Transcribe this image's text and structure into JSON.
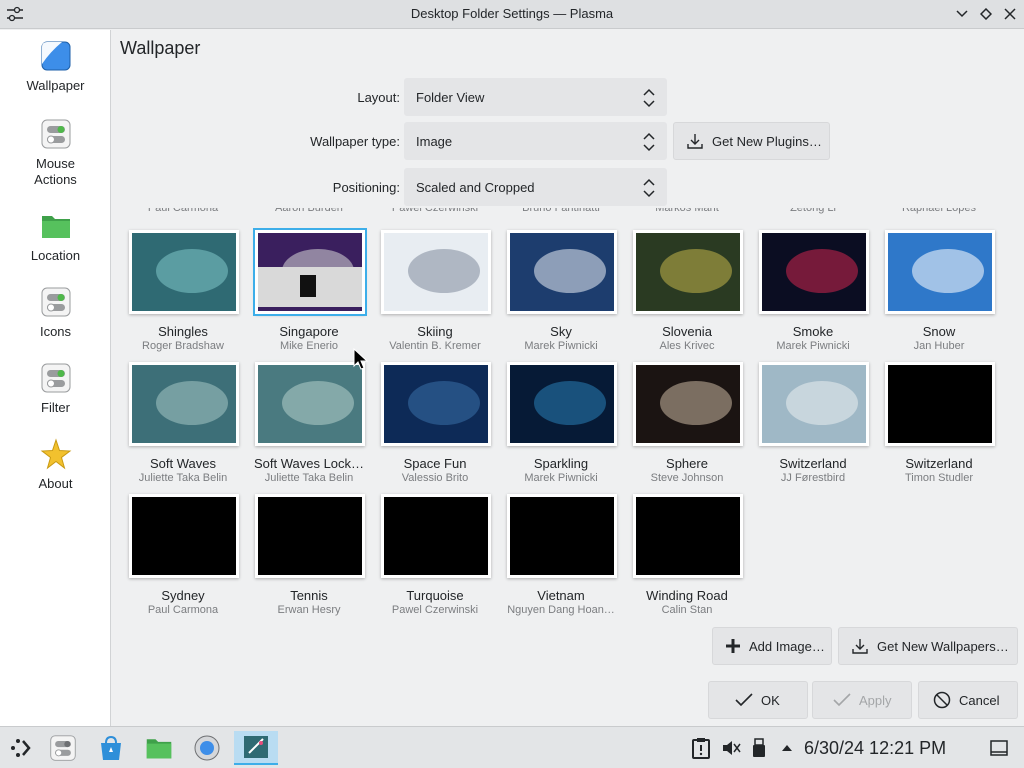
{
  "window": {
    "title": "Desktop Folder Settings — Plasma",
    "app_icon": "settings-sliders-icon",
    "controls": [
      "chevron-down-icon",
      "diamond-icon",
      "close-icon"
    ]
  },
  "sidebar": {
    "items": [
      {
        "label": "Wallpaper",
        "icon": "wallpaper-icon"
      },
      {
        "label": "Mouse\nActions",
        "label_line1": "Mouse",
        "label_line2": "Actions",
        "icon": "toggle-settings-icon"
      },
      {
        "label": "Location",
        "icon": "folder-icon"
      },
      {
        "label": "Icons",
        "icon": "toggle-settings-icon"
      },
      {
        "label": "Filter",
        "icon": "toggle-settings-icon"
      },
      {
        "label": "About",
        "icon": "star-icon"
      }
    ]
  },
  "main": {
    "title": "Wallpaper",
    "layout": {
      "label": "Layout:",
      "value": "Folder View"
    },
    "wallpaper_type": {
      "label": "Wallpaper type:",
      "value": "Image"
    },
    "get_new_plugins": "Get New Plugins…",
    "positioning": {
      "label": "Positioning:",
      "value": "Scaled and Cropped"
    },
    "partial_authors": [
      "Paul Carmona",
      "Aaron Burden",
      "Pawel Czerwinski",
      "Bruno Fantinatti",
      "Markos Mant",
      "Zetong Li",
      "Raphael Lopes"
    ],
    "wallpapers": [
      {
        "name": "Shingles",
        "author": "Roger Bradshaw",
        "bg": "#2f6a73",
        "fg": "#7fc6c8",
        "selected": false
      },
      {
        "name": "Singapore",
        "author": "Mike Enerio",
        "bg": "#3a1f5e",
        "fg": "#d9d9d9",
        "selected": true
      },
      {
        "name": "Skiing",
        "author": "Valentin B. Kremer",
        "bg": "#e8edf2",
        "fg": "#7f8a9c",
        "selected": false
      },
      {
        "name": "Sky",
        "author": "Marek Piwnicki",
        "bg": "#1d3d6e",
        "fg": "#e9eef5",
        "selected": false
      },
      {
        "name": "Slovenia",
        "author": "Ales Krivec",
        "bg": "#2a3a22",
        "fg": "#c3b54a",
        "selected": false
      },
      {
        "name": "Smoke",
        "author": "Marek Piwnicki",
        "bg": "#0b0d22",
        "fg": "#d0274f",
        "selected": false
      },
      {
        "name": "Snow",
        "author": "Jan Huber",
        "bg": "#2f78c9",
        "fg": "#ffffff",
        "selected": false
      },
      {
        "name": "Soft Waves",
        "author": "Juliette Taka Belin",
        "bg": "#3d6f78",
        "fg": "#a6c6c4",
        "selected": false
      },
      {
        "name": "Soft Waves Lock…",
        "author": "Juliette Taka Belin",
        "bg": "#4a7a80",
        "fg": "#b4cfca",
        "selected": false
      },
      {
        "name": "Space Fun",
        "author": "Valessio Brito",
        "bg": "#0d2a57",
        "fg": "#3b70a8",
        "selected": false
      },
      {
        "name": "Sparkling",
        "author": "Marek Piwnicki",
        "bg": "#061a36",
        "fg": "#2a80b6",
        "selected": false
      },
      {
        "name": "Sphere",
        "author": "Steve Johnson",
        "bg": "#1b1412",
        "fg": "#cbb8a3",
        "selected": false
      },
      {
        "name": "Switzerland",
        "author": "JJ Førestbird",
        "bg": "#9fb8c6",
        "fg": "#e9eef1",
        "selected": false
      },
      {
        "name": "Switzerland",
        "author": "Timon Studler",
        "bg": "#000000",
        "fg": "#000000",
        "selected": false
      },
      {
        "name": "Sydney",
        "author": "Paul Carmona",
        "bg": "#000000",
        "fg": "#000000",
        "selected": false
      },
      {
        "name": "Tennis",
        "author": "Erwan Hesry",
        "bg": "#000000",
        "fg": "#000000",
        "selected": false
      },
      {
        "name": "Turquoise",
        "author": "Pawel Czerwinski",
        "bg": "#000000",
        "fg": "#000000",
        "selected": false
      },
      {
        "name": "Vietnam",
        "author": "Nguyen Dang Hoan…",
        "bg": "#000000",
        "fg": "#000000",
        "selected": false
      },
      {
        "name": "Winding Road",
        "author": "Calin Stan",
        "bg": "#000000",
        "fg": "#000000",
        "selected": false
      }
    ],
    "add_image": "Add Image…",
    "get_new_wallpapers": "Get New Wallpapers…"
  },
  "buttons": {
    "ok": "OK",
    "apply": "Apply",
    "cancel": "Cancel"
  },
  "taskbar": {
    "clock": "6/30/24 12:21 PM",
    "items": [
      "app-launcher-icon",
      "system-settings-icon",
      "discover-store-icon",
      "file-manager-icon",
      "browser-icon",
      "active-window-icon"
    ],
    "tray": [
      "clipboard-icon",
      "volume-muted-icon",
      "usb-device-icon",
      "tray-expand-icon",
      "show-desktop-icon"
    ]
  },
  "colors": {
    "accent": "#3daee9",
    "window_bg": "#eff0f1",
    "sidebar_bg": "#ffffff",
    "button_bg": "#e4e5e7"
  }
}
